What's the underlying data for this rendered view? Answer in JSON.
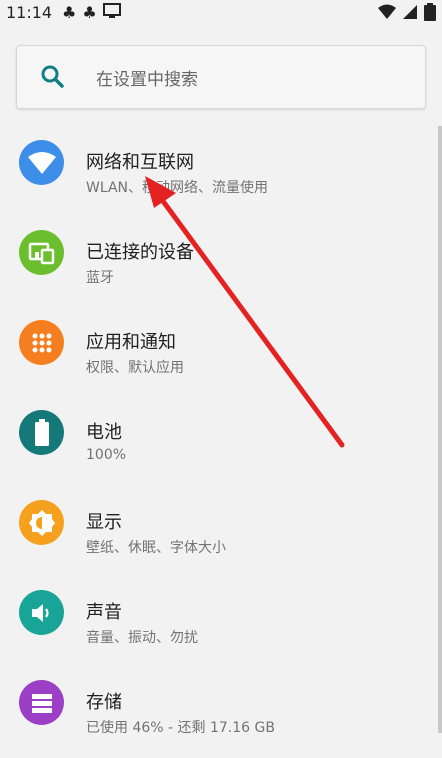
{
  "status": {
    "time": "11:14"
  },
  "search": {
    "placeholder": "在设置中搜索"
  },
  "items": [
    {
      "title": "网络和互联网",
      "subtitle": "WLAN、移动网络、流量使用",
      "color": "#3d8ee8",
      "icon": "wifi-icon"
    },
    {
      "title": "已连接的设备",
      "subtitle": "蓝牙",
      "color": "#6bbf2e",
      "icon": "devices-icon"
    },
    {
      "title": "应用和通知",
      "subtitle": "权限、默认应用",
      "color": "#f57f20",
      "icon": "apps-grid-icon"
    },
    {
      "title": "电池",
      "subtitle": "100%",
      "color": "#167979",
      "icon": "battery-icon"
    },
    {
      "title": "显示",
      "subtitle": "壁纸、休眠、字体大小",
      "color": "#f5a11d",
      "icon": "brightness-icon"
    },
    {
      "title": "声音",
      "subtitle": "音量、振动、勿扰",
      "color": "#18a597",
      "icon": "volume-icon"
    },
    {
      "title": "存储",
      "subtitle": "已使用 46% - 还剩 17.16 GB",
      "color": "#9c3fc7",
      "icon": "storage-icon"
    }
  ],
  "annotation": {
    "arrow_color": "#e52222"
  }
}
